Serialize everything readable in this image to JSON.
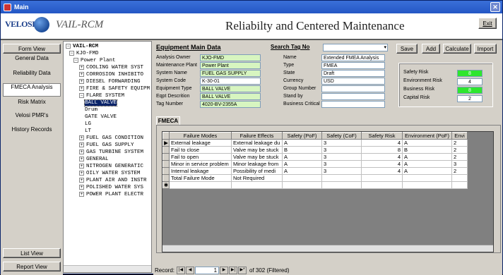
{
  "window": {
    "title": "Main"
  },
  "header": {
    "logo": "VELOSI",
    "subtitle": "VAIL-RCM",
    "title": "Reliabilty and Centered Maintenance",
    "exit_label": "Exit"
  },
  "leftnav": {
    "top_button": "Form View",
    "items": [
      {
        "label": "General Data"
      },
      {
        "label": "Reliability Data"
      },
      {
        "label": "FMECA Analysis"
      },
      {
        "label": "Risk Matrix"
      },
      {
        "label": "Velosi PMR's"
      },
      {
        "label": "History Records"
      }
    ],
    "list_view": "List View",
    "report_view": "Report View"
  },
  "tree": {
    "root": "VAIL-RCM",
    "nodes": [
      {
        "label": "KJO-FMD",
        "expander": "−"
      },
      {
        "label": "Power Plant",
        "expander": "−"
      },
      {
        "label": "COOLING WATER SYST",
        "expander": "+"
      },
      {
        "label": "CORROSION INHIBITO",
        "expander": "+"
      },
      {
        "label": "DIESEL FORWARDING",
        "expander": "+"
      },
      {
        "label": "FIRE & SAFETY EQUIPM",
        "expander": "+"
      },
      {
        "label": "FLARE SYSTEM",
        "expander": "−"
      },
      {
        "label": "BALL VALVE",
        "expander": ""
      },
      {
        "label": "Drum",
        "expander": ""
      },
      {
        "label": "GATE VALVE",
        "expander": ""
      },
      {
        "label": "LG",
        "expander": ""
      },
      {
        "label": "LT",
        "expander": ""
      },
      {
        "label": "FUEL GAS CONDITION",
        "expander": "+"
      },
      {
        "label": "FUEL GAS SUPPLY",
        "expander": "+"
      },
      {
        "label": "GAS TURBINE SYSTEM",
        "expander": "+"
      },
      {
        "label": "GENERAL",
        "expander": "+"
      },
      {
        "label": "NITROGEN GENERATIC",
        "expander": "+"
      },
      {
        "label": "OILY WATER SYSTEM",
        "expander": "+"
      },
      {
        "label": "PLANT AIR AND INSTR",
        "expander": "+"
      },
      {
        "label": "POLISHED WATER SYS",
        "expander": "+"
      },
      {
        "label": "POWER PLANT ELECTR",
        "expander": "+"
      }
    ]
  },
  "form": {
    "title": "Equipment Main Data",
    "search_label": "Search Tag No",
    "search_value": "",
    "left_fields": [
      {
        "label": "Analysis Owner",
        "value": "KJO-FMD"
      },
      {
        "label": "Maintenance Plant",
        "value": "Power Plant"
      },
      {
        "label": "System Name",
        "value": "FUEL GAS SUPPLY"
      },
      {
        "label": "System Code",
        "value": "K-30-01"
      },
      {
        "label": "Equipment Type",
        "value": "BALL VALVE"
      },
      {
        "label": "Eqpt Descrition",
        "value": "BALL VALVE"
      },
      {
        "label": "Tag Number",
        "value": "4020-BV-2355A"
      }
    ],
    "right_fields": [
      {
        "label": "Name",
        "value": "Extended FMEA Analysis"
      },
      {
        "label": "Type",
        "value": "FMEA"
      },
      {
        "label": "State",
        "value": "Draft"
      },
      {
        "label": "Currency",
        "value": "USD"
      },
      {
        "label": "Group Number",
        "value": ""
      },
      {
        "label": "Stand by",
        "value": ""
      },
      {
        "label": "Business Critical",
        "value": ""
      }
    ],
    "buttons": {
      "save": "Save",
      "add": "Add",
      "calculate": "Calculate",
      "import": "Import"
    }
  },
  "risk": {
    "items": [
      {
        "label": "Safety Risk",
        "value": "8"
      },
      {
        "label": "Environment Risk",
        "value": "4"
      },
      {
        "label": "Business Risk",
        "value": "8"
      },
      {
        "label": "Capital Risk",
        "value": "2"
      }
    ],
    "highlight_color": "#2ee62e"
  },
  "tabs": {
    "fmea": "FMECA"
  },
  "grid": {
    "columns": [
      "Failure Modes",
      "Failure Effects",
      "Safety (PoF)",
      "Safety (CoF)",
      "Safety Risk",
      "Environment (PoF)",
      "Envi"
    ],
    "rows": [
      [
        "External leakage",
        "External leakage du",
        "A",
        "3",
        "4",
        "A",
        "2"
      ],
      [
        "Fail to close",
        "Valve may be stuck",
        "B",
        "3",
        "8",
        "B",
        "2"
      ],
      [
        "Fail to open",
        "Valve may be stuck",
        "A",
        "3",
        "4",
        "A",
        "2"
      ],
      [
        "Minor in service problem",
        "Minor leakage from",
        "A",
        "3",
        "4",
        "A",
        "3"
      ],
      [
        "Internal leakage",
        "Possibility of medi",
        "A",
        "3",
        "4",
        "A",
        "2"
      ],
      [
        "Total Failure Mode",
        "Not Required",
        "",
        "",
        "",
        "",
        ""
      ]
    ]
  },
  "recordbar": {
    "label": "Record:",
    "current": "1",
    "of_text": "of  302 (Filtered)"
  }
}
